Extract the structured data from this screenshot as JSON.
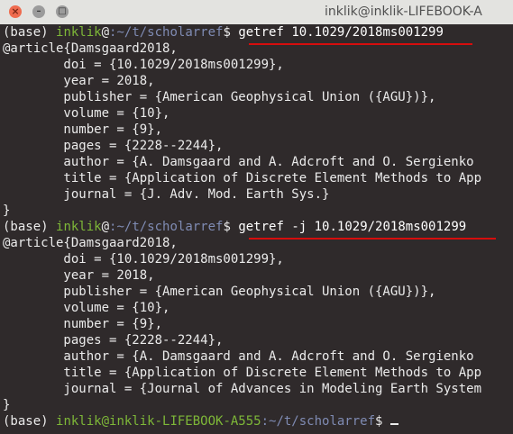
{
  "window": {
    "title": "inklik@inklik-LIFEBOOK-A",
    "close_glyph": "×",
    "min_glyph": "–",
    "max_glyph": "□"
  },
  "colors": {
    "background": "#2f2a2b",
    "user": "#7eb838",
    "path": "#7f8bb3",
    "text": "#ebebeb",
    "annotation": "#d60d0d"
  },
  "terminal": {
    "prompt1": {
      "env": "(base) ",
      "user": "inklik",
      "at": "@",
      "path": ":~/t/scholarref",
      "dollar": "$ ",
      "command": "getref 10.1029/2018ms001299"
    },
    "output1": [
      "@article{Damsgaard2018,",
      "        doi = {10.1029/2018ms001299},",
      "        year = 2018,",
      "        publisher = {American Geophysical Union ({AGU})},",
      "        volume = {10},",
      "        number = {9},",
      "        pages = {2228--2244},",
      "        author = {A. Damsgaard and A. Adcroft and O. Sergienko",
      "        title = {Application of Discrete Element Methods to App",
      "        journal = {J. Adv. Mod. Earth Sys.}",
      "}"
    ],
    "prompt2": {
      "env": "(base) ",
      "user": "inklik",
      "at": "@",
      "path": ":~/t/scholarref",
      "dollar": "$ ",
      "command": "getref -j 10.1029/2018ms001299"
    },
    "output2": [
      "@article{Damsgaard2018,",
      "        doi = {10.1029/2018ms001299},",
      "        year = 2018,",
      "        publisher = {American Geophysical Union ({AGU})},",
      "        volume = {10},",
      "        number = {9},",
      "        pages = {2228--2244},",
      "        author = {A. Damsgaard and A. Adcroft and O. Sergienko",
      "        title = {Application of Discrete Element Methods to App",
      "        journal = {Journal of Advances in Modeling Earth System",
      "}"
    ],
    "prompt3": {
      "env": "(base) ",
      "user": "inklik@inklik-LIFEBOOK-A555",
      "path": ":~/t/scholarref",
      "dollar": "$ "
    }
  }
}
